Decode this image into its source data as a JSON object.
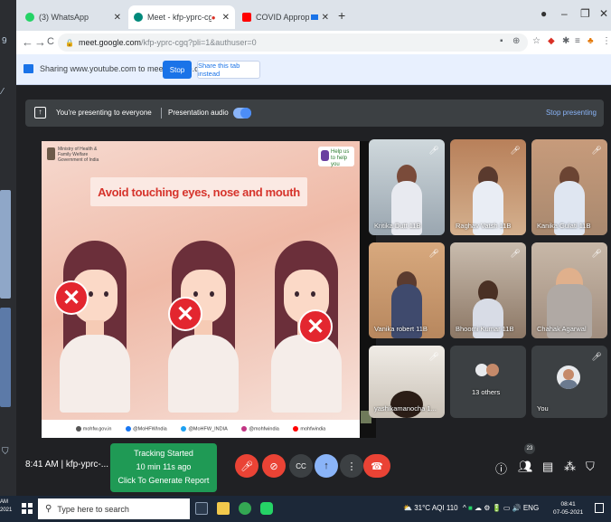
{
  "browser": {
    "tabs": [
      {
        "title": "(3) WhatsApp",
        "color": "#25d366"
      },
      {
        "title": "Meet - kfp-yprc-cgq",
        "color": "#00897b"
      },
      {
        "title": "COVID Appropriate Behavi",
        "color": "#ff0000"
      }
    ],
    "new_tab": "+",
    "url_host": "meet.google.com",
    "url_path": "/kfp-yprc-cgq?pli=1&authuser=0"
  },
  "share_bar": {
    "text": "Sharing www.youtube.com to meet.google.com",
    "stop_label": "Stop",
    "share_tab_label": "Share this tab instead"
  },
  "presenting": {
    "text": "You're presenting to everyone",
    "audio_label": "Presentation audio",
    "stop_label": "Stop presenting"
  },
  "slide": {
    "ministry": "Ministry of Health & Family Welfare Government of India",
    "help": "Help us to help you",
    "headline": "Avoid touching eyes, nose and mouth",
    "footer": [
      {
        "text": "mohfw.gov.in",
        "color": "#555"
      },
      {
        "text": "@MoHFWIndia",
        "color": "#1877f2"
      },
      {
        "text": "@MoHFW_INDIA",
        "color": "#1da1f2"
      },
      {
        "text": "@mohfwindia",
        "color": "#c13584"
      },
      {
        "text": "mohfwindia",
        "color": "#ff0000"
      }
    ]
  },
  "participants": [
    {
      "name": "Kritika Dutt 11B"
    },
    {
      "name": "Raghav Vatsh 11B"
    },
    {
      "name": "Kanika Gulati 11B"
    },
    {
      "name": "Vanika robert 11B"
    },
    {
      "name": "Bhoomi Kumar 11B"
    },
    {
      "name": "Chahak Agarwal"
    },
    {
      "name": "yashikamanocha 1..."
    },
    {
      "name": "13 others"
    },
    {
      "name": "You"
    }
  ],
  "bottom": {
    "time_code": "8:41 AM  |  kfp-yprc-...",
    "tracking_line1": "Tracking Started",
    "tracking_line2": "10 min 11s ago",
    "tracking_line3": "Click To Generate Report",
    "participants_count": "23"
  },
  "taskbar": {
    "search_placeholder": "Type here to search",
    "weather": "31°C  AQI 110",
    "lang": "ENG",
    "time": "08:41",
    "date": "07-05-2021",
    "left_time": "AM",
    "left_year": "2021"
  }
}
